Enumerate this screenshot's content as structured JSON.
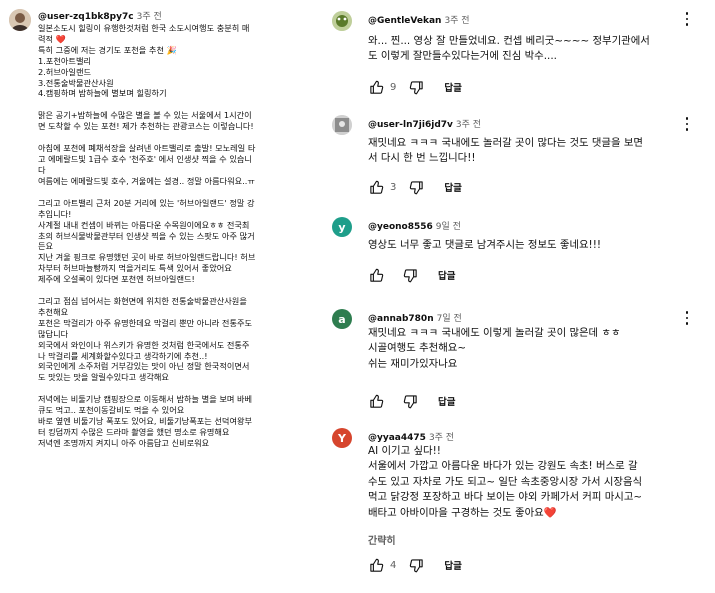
{
  "left_comment": {
    "handle": "@user-zq1bk8py7c",
    "age": "3주 전",
    "paragraphs": [
      [
        "일본소도시 힐링이 유행한것처럼 한국 소도시여행도 충분히 매",
        "력적 ❤️",
        "특히 그중에 저는 경기도 포천을 추천 🎉",
        "1.포천아트밸리",
        "2.허브아일랜드",
        "3.전통술박물관산사원",
        "4.캠핑하며 밤하늘에 별보며 힐링하기"
      ],
      [
        "맑은 공기+밤하늘에 수많은 별을 볼 수 있는 서울에서 1시간이",
        "면 도착할 수 있는 포천! 제가 추천하는 관광코스는 이렇습니다!"
      ],
      [
        "아침에 포천에 폐채석장을 살려낸 아트밸리로 출발! 모노레일 타",
        "고 에메랄드빛 1급수 호수 '천주호' 에서 인생샷 찍을 수 있습니",
        "다",
        "여름에는 에메랄드빛 호수, 겨울에는 설경.. 정말 아름다워요..ㅠ"
      ],
      [
        "그리고 아트밸리 근처 20분 거리에 있는 '허브아일랜드' 정말 강",
        "추입니다!",
        "사계절 내내 컨셉이 바뀌는 아름다운 수목원이에요ㅎㅎ 전국최",
        "초의 허브식물박물관부터 인생샷 찍을 수 있는 스팟도 아주 많거",
        "든요",
        "지난 겨울 핑크로 유명했던 곳이 바로 허브아일랜드랍니다! 허브",
        "차부터 허브마늘빵까지 먹을거리도 특색 있어서 좋았어요",
        "제주에 오설록이 있다면 포천엔 허브아일랜드!"
      ],
      [
        "그리고 점심 넘어서는 화현면에 위치한 전통술박물관산사원을",
        "추천해요",
        "포천은 막걸리가 아주 유명한데요 막걸리 뿐만 아니라 전통주도",
        "많답니다",
        "외국에서 와인이나 위스키가 유명한 것처럼 한국에서도 전통주",
        "나 막걸리를 세계화할수있다고 생각하기에 추천..!",
        "외국인에게 소주처럼 거부감있는 맛이 아닌 정말 한국적이면서",
        "도 맛있는 맛을 알릴수있다고 생각해요"
      ],
      [
        "저녁에는 비둘기낭 캠핑장으로 이동해서 밤하늘 별을 보며 바베",
        "큐도 먹고.. 포천이동갈비도 먹을 수 있어요",
        "바로 옆엔 비둘기낭 폭포도 있어요, 비둘기낭폭포는 선덕여왕부",
        "터 킹덤까지 수많은 드라마 촬영을 했던 명소로 유명해요",
        "저녁엔 조명까지 켜지니 아주 아름답고 신비로워요"
      ]
    ]
  },
  "right_comments": [
    {
      "handle": "@GentleVekan",
      "age": "3주 전",
      "avatar_color": "#4a7f3a",
      "lines": [
        "와... 찐... 영상 잘 만들었네요. 컨셉 베리굿~~~~ 정부기관에서",
        "도 이렇게 잘만들수있다는거에 진심 박수...."
      ],
      "likes": "9",
      "reply": "답글"
    },
    {
      "handle": "@user-ln7ji6jd7v",
      "age": "3주 전",
      "avatar_color": "#8a8a8a",
      "lines": [
        "재밋네요 ㅋㅋㅋ 국내에도 놀러갈 곳이 많다는 것도 댓글을 보면",
        "서 다시 한 번 느낍니다!!"
      ],
      "likes": "3",
      "reply": "답글"
    },
    {
      "handle": "@yeono8556",
      "age": "9일 전",
      "avatar_letter": "y",
      "avatar_color": "#1e9e8a",
      "lines": [
        "영상도 너무 좋고 댓글로 남겨주시는 정보도 좋네요!!!"
      ],
      "likes": "",
      "reply": "답글"
    },
    {
      "handle": "@annab780n",
      "age": "7일 전",
      "avatar_letter": "a",
      "avatar_color": "#2e7d4f",
      "lines": [
        "재밋네요 ㅋㅋㅋ 국내에도 이렇게 놀러갈 곳이 많은데 ㅎㅎ",
        "시골여행도 추천해요~",
        "쉬는 재미가있자나요"
      ],
      "likes": "",
      "reply": "답글"
    },
    {
      "handle": "@yyaa4475",
      "age": "3주 전",
      "avatar_letter": "Y",
      "avatar_color": "#d6452d",
      "lines": [
        "AI 이기고 싶다!!",
        "서울에서 가깝고 아름다운 바다가 있는 강원도 속초! 버스로 갈",
        "수도 있고 자차로 가도 되고~ 일단 속초중앙시장 가서 시장음식",
        "먹고 닭강정 포장하고 바다 보이는 야외 카페가서 커피 마시고~",
        "배타고 아바이마을 구경하는 것도 좋아요❤️"
      ],
      "readmore": "간략히",
      "likes": "4",
      "reply": "답글"
    }
  ]
}
